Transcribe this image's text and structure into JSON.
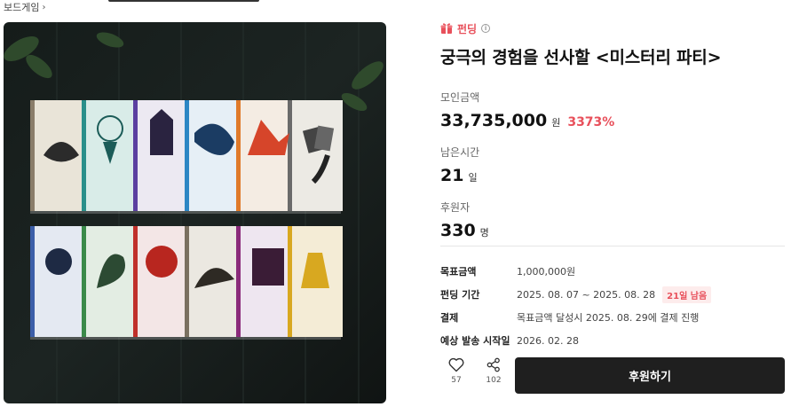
{
  "breadcrumb": {
    "category": "보드게임",
    "chevron": "›"
  },
  "badge": {
    "label": "펀딩",
    "info": "i"
  },
  "project": {
    "title": "궁극의 경험을 선사할 <미스터리 파티>"
  },
  "stats": {
    "raised": {
      "label": "모인금액",
      "value": "33,735,000",
      "unit": "원",
      "percent": "3373%"
    },
    "remaining": {
      "label": "남은시간",
      "value": "21",
      "unit": "일"
    },
    "backers": {
      "label": "후원자",
      "value": "330",
      "unit": "명"
    }
  },
  "details": {
    "goal": {
      "label": "목표금액",
      "value": "1,000,000원"
    },
    "period": {
      "label": "펀딩 기간",
      "value": "2025. 08. 07 ~ 2025. 08. 28",
      "remain_badge": "21일 남음"
    },
    "payment": {
      "label": "결제",
      "value": "목표금액 달성시 2025. 08. 29에 결제 진행"
    },
    "shipping": {
      "label": "예상 발송 시작일",
      "value": "2026. 02. 28"
    }
  },
  "actions": {
    "like_count": "57",
    "share_count": "102",
    "support_label": "후원하기"
  },
  "icons": {
    "gift": "gift-icon",
    "heart": "heart-icon",
    "share": "share-icon"
  },
  "colors": {
    "accent": "#e8505b",
    "button": "#1f1f1f"
  }
}
